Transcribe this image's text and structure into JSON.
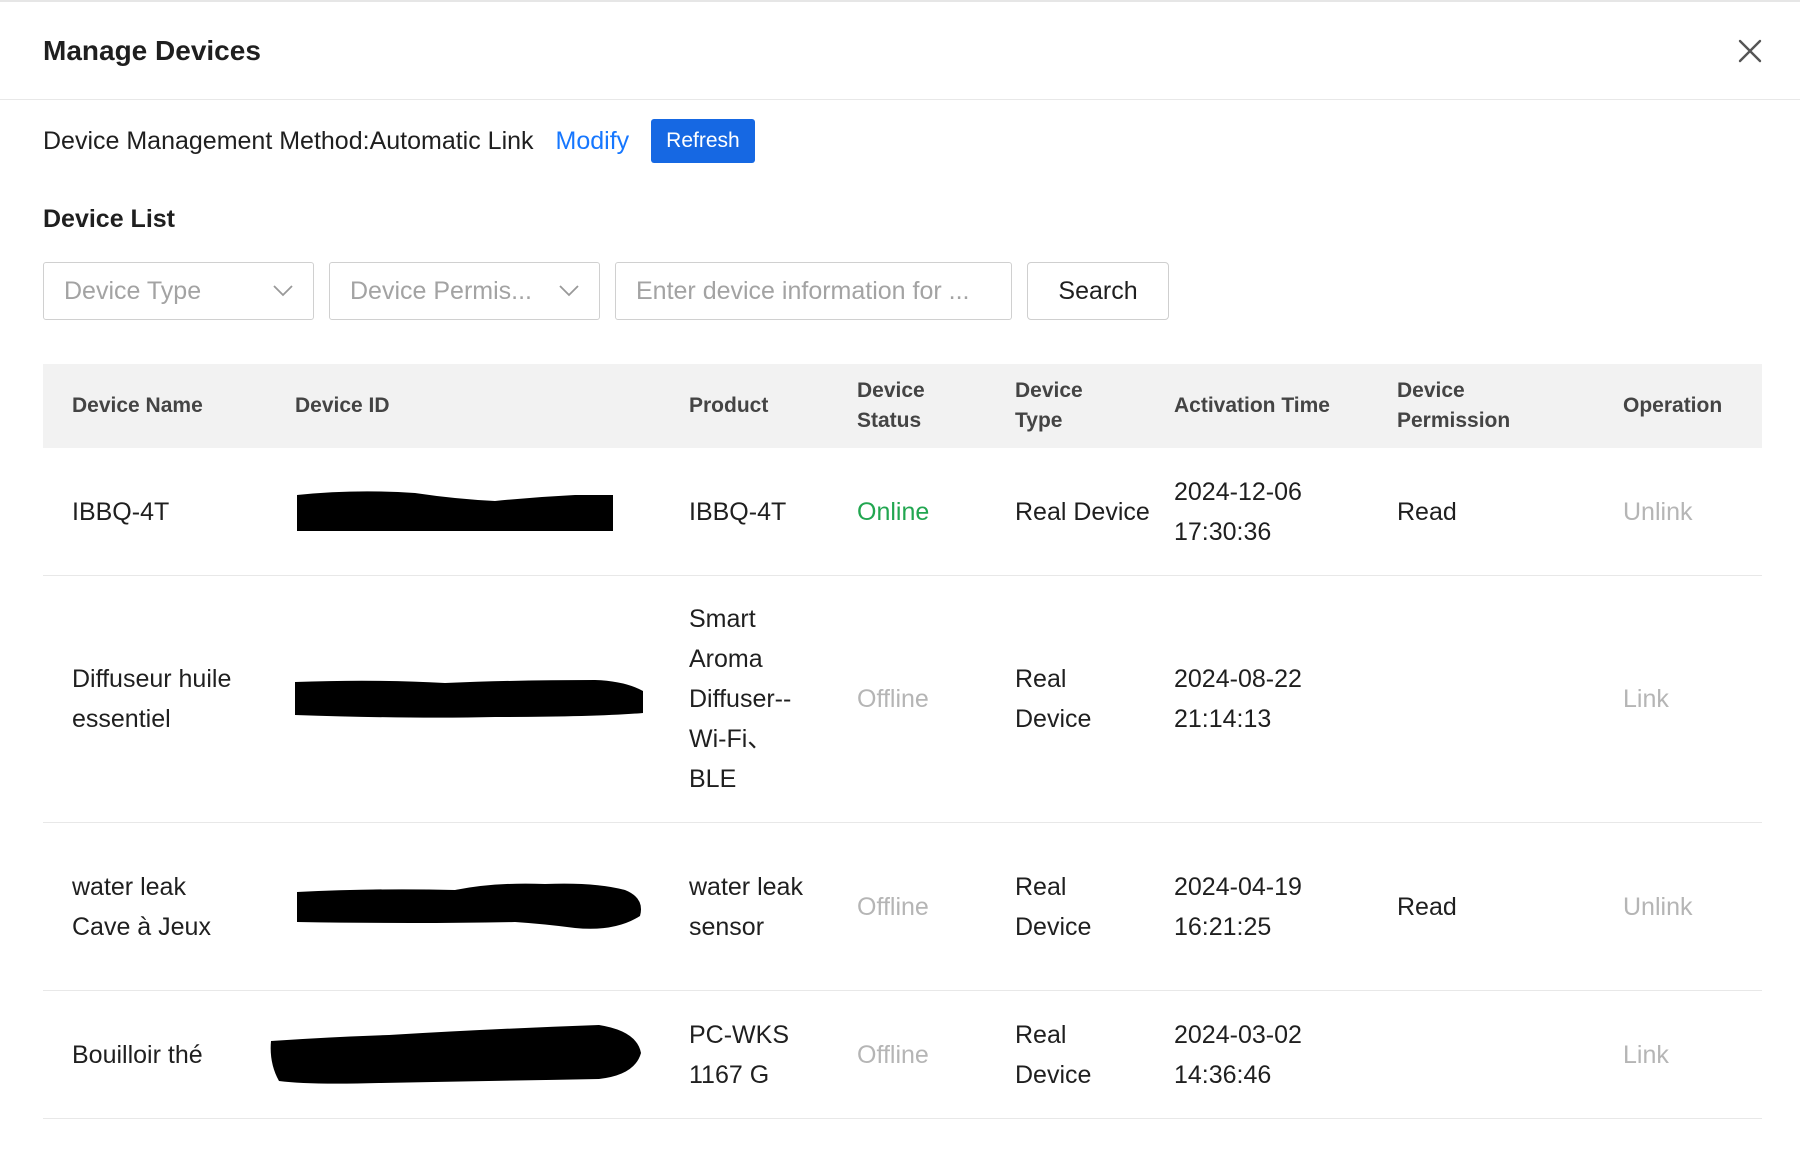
{
  "modal": {
    "title": "Manage Devices"
  },
  "method": {
    "text": "Device Management Method:Automatic Link",
    "modify_label": "Modify",
    "refresh_label": "Refresh"
  },
  "list": {
    "title": "Device List"
  },
  "filters": {
    "device_type_placeholder": "Device Type",
    "device_permission_placeholder": "Device Permis...",
    "search_placeholder": "Enter device information for ...",
    "search_label": "Search"
  },
  "table": {
    "headers": [
      "Device Name",
      "Device ID",
      "Product",
      "Device Status",
      "Device Type",
      "Activation Time",
      "Device Permission",
      "Operation"
    ],
    "rows": [
      {
        "name": "IBBQ-4T",
        "product": "IBBQ-4T",
        "status": "Online",
        "type": "Real Device",
        "time": "2024-12-06 17:30:36",
        "permission": "Read",
        "operation": "Unlink"
      },
      {
        "name": "Diffuseur huile essentiel",
        "product": "Smart Aroma Diffuser--Wi-Fi、BLE",
        "status": "Offline",
        "type": "Real Device",
        "time": "2024-08-22 21:14:13",
        "permission": "",
        "operation": "Link"
      },
      {
        "name": "water leak Cave à Jeux",
        "product": "water leak sensor",
        "status": "Offline",
        "type": "Real Device",
        "time": "2024-04-19 16:21:25",
        "permission": "Read",
        "operation": "Unlink"
      },
      {
        "name": "Bouilloir thé",
        "product": "PC-WKS 1167 G",
        "status": "Offline",
        "type": "Real Device",
        "time": "2024-03-02 14:36:46",
        "permission": "",
        "operation": "Link"
      }
    ]
  },
  "icons": {
    "close": "close-icon",
    "dropdown": "chevron-down-icon"
  },
  "colors": {
    "accent": "#1668e3",
    "link": "#1677ff",
    "online": "#21a650",
    "muted": "#b5b5b5",
    "header_bg": "#f2f2f2"
  }
}
